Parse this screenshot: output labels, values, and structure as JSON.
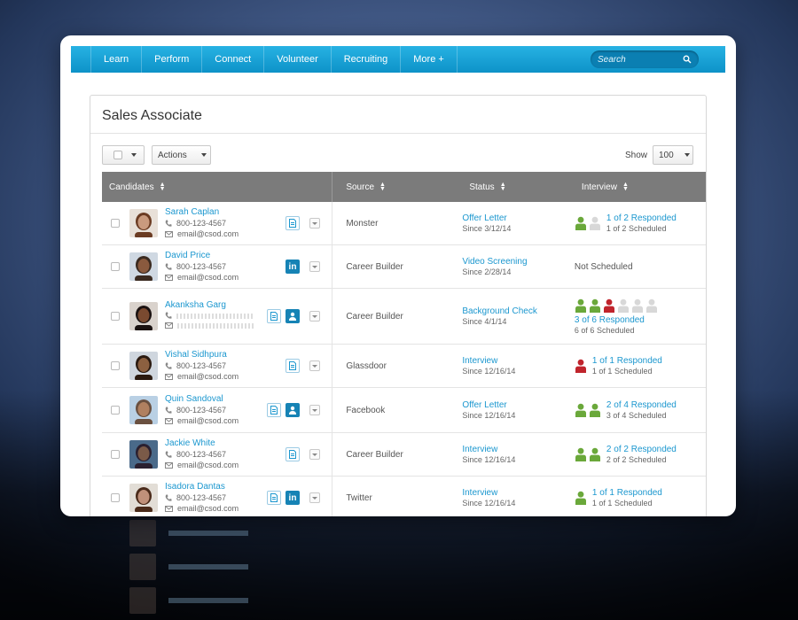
{
  "nav": {
    "items": [
      "Learn",
      "Perform",
      "Connect",
      "Volunteer",
      "Recruiting",
      "More +"
    ],
    "search_placeholder": "Search"
  },
  "page": {
    "title": "Sales Associate",
    "actions_label": "Actions",
    "show_label": "Show",
    "show_value": "100"
  },
  "table": {
    "headers": {
      "candidates": "Candidates",
      "source": "Source",
      "status": "Status",
      "interview": "Interview"
    },
    "rows": [
      {
        "name": "Sarah Caplan",
        "phone": "800-123-4567",
        "email": "email@csod.com",
        "source": "Monster",
        "status": "Offer Letter",
        "since": "Since 3/12/14",
        "responded": "1 of 2 Responded",
        "scheduled": "1 of 2 Scheduled",
        "icons": [
          "green",
          "gray"
        ]
      },
      {
        "name": "David Price",
        "phone": "800-123-4567",
        "email": "email@csod.com",
        "source": "Career Builder",
        "status": "Video Screening",
        "since": "Since 2/28/14",
        "not_scheduled": "Not Scheduled"
      },
      {
        "name": "Akanksha Garg",
        "source": "Career Builder",
        "status": "Background Check",
        "since": "Since 4/1/14",
        "responded": "3 of 6 Responded",
        "scheduled": "6 of 6 Scheduled",
        "icons": [
          "green",
          "green",
          "red",
          "gray",
          "gray",
          "gray"
        ]
      },
      {
        "name": "Vishal Sidhpura",
        "phone": "800-123-4567",
        "email": "email@csod.com",
        "source": "Glassdoor",
        "status": "Interview",
        "since": "Since 12/16/14",
        "responded": "1 of 1 Responded",
        "scheduled": "1 of 1 Scheduled",
        "icons": [
          "red"
        ]
      },
      {
        "name": "Quin Sandoval",
        "phone": "800-123-4567",
        "email": "email@csod.com",
        "source": "Facebook",
        "status": "Offer Letter",
        "since": "Since 12/16/14",
        "responded": "2 of 4 Responded",
        "scheduled": "3 of 4 Scheduled",
        "icons": [
          "green",
          "green"
        ]
      },
      {
        "name": "Jackie White",
        "phone": "800-123-4567",
        "email": "email@csod.com",
        "source": "Career Builder",
        "status": "Interview",
        "since": "Since 12/16/14",
        "responded": "2 of 2 Responded",
        "scheduled": "2 of 2 Scheduled",
        "icons": [
          "green",
          "green"
        ]
      },
      {
        "name": "Isadora Dantas",
        "phone": "800-123-4567",
        "email": "email@csod.com",
        "source": "Twitter",
        "status": "Interview",
        "since": "Since 12/16/14",
        "responded": "1 of 1 Responded",
        "scheduled": "1 of 1 Scheduled",
        "icons": [
          "green"
        ]
      }
    ]
  },
  "colors": {
    "accent": "#1b97cf",
    "nav": "#16a3d8",
    "header_gray": "#7b7b7b",
    "green": "#6aa83a",
    "red": "#c0242c",
    "gray": "#d8d8d8"
  }
}
